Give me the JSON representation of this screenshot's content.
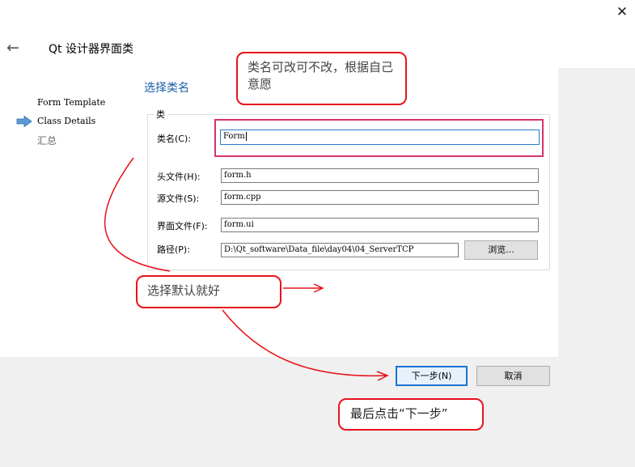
{
  "window": {
    "title": "Qt 设计器界面类",
    "close_glyph": "✕",
    "back_glyph": "←"
  },
  "sidebar": {
    "steps": [
      {
        "label": "Form Template",
        "active": false
      },
      {
        "label": "Class Details",
        "active": true
      },
      {
        "label": "汇总",
        "active": false
      }
    ],
    "active_indicator_color": "#5b9bd5"
  },
  "page": {
    "heading": "选择类名",
    "group_title": "类"
  },
  "form": {
    "class_name_label": "类名(C):",
    "class_name_value": "Form",
    "header_label": "头文件(H):",
    "header_value": "form.h",
    "source_label": "源文件(S):",
    "source_value": "form.cpp",
    "form_file_label": "界面文件(F):",
    "form_file_value": "form.ui",
    "path_label": "路径(P):",
    "path_value": "D:\\Qt_software\\Data_file\\day04\\04_ServerTCP",
    "browse_label": "浏览..."
  },
  "footer": {
    "next_label": "下一步(N)",
    "cancel_label": "取消"
  },
  "annotations": {
    "note_class_name": "类名可改可不改，根据自己意愿",
    "note_default": "选择默认就好",
    "note_next": "最后点击“下一步”",
    "color": "#e8121b"
  }
}
